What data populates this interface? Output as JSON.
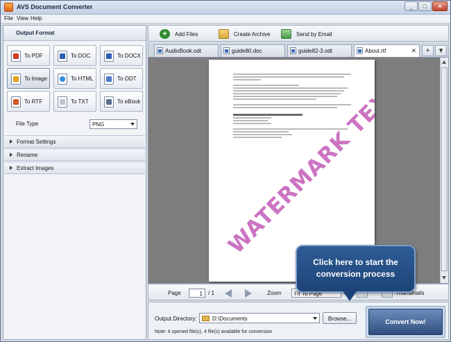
{
  "window": {
    "title": "AVS Document Converter"
  },
  "menu": {
    "file": "File",
    "view": "View",
    "help": "Help"
  },
  "left_panel": {
    "header": "Output Format",
    "formats": [
      {
        "label": "To PDF",
        "icon": "pdf-icon"
      },
      {
        "label": "To DOC",
        "icon": "doc-icon"
      },
      {
        "label": "To DOCX",
        "icon": "docx-icon"
      },
      {
        "label": "To Image",
        "icon": "image-icon"
      },
      {
        "label": "To HTML",
        "icon": "html-icon"
      },
      {
        "label": "To ODT",
        "icon": "odt-icon"
      },
      {
        "label": "To RTF",
        "icon": "rtf-icon"
      },
      {
        "label": "To TXT",
        "icon": "txt-icon"
      },
      {
        "label": "To eBook",
        "icon": "ebook-icon"
      }
    ],
    "active_format": "To Image",
    "file_type_label": "File Type",
    "file_type_value": "PNG",
    "sections": [
      "Format Settings",
      "Rename",
      "Extract Images"
    ]
  },
  "toolbar": {
    "add_files": "Add Files",
    "create_archive": "Create Archive",
    "send_by_email": "Send by Email"
  },
  "tabs": [
    {
      "label": "AudioBook.odt"
    },
    {
      "label": "guide80.doc"
    },
    {
      "label": "guide82-3.odt"
    },
    {
      "label": "About.rtf",
      "active": true
    }
  ],
  "preview": {
    "watermark": "WATERMARK TEXT"
  },
  "navigation": {
    "page_label": "Page",
    "page_value": "1",
    "page_total": "/ 1",
    "zoom_label": "Zoom",
    "zoom_value": "Fit To Page",
    "thumbnails_label": "Thumbnails"
  },
  "output": {
    "dir_label": "Output Directory:",
    "dir_value": "D:\\Documents",
    "browse": "Browse...",
    "note": "Note: 4 opened file(s), 4 file(s) available for conversion",
    "convert": "Convert Now!"
  },
  "callout": {
    "line1": "Click here to start the",
    "line2": "conversion process"
  },
  "colors": {
    "accent": "#2f4f80",
    "callout": "#1d4478",
    "watermark": "#b946af"
  }
}
